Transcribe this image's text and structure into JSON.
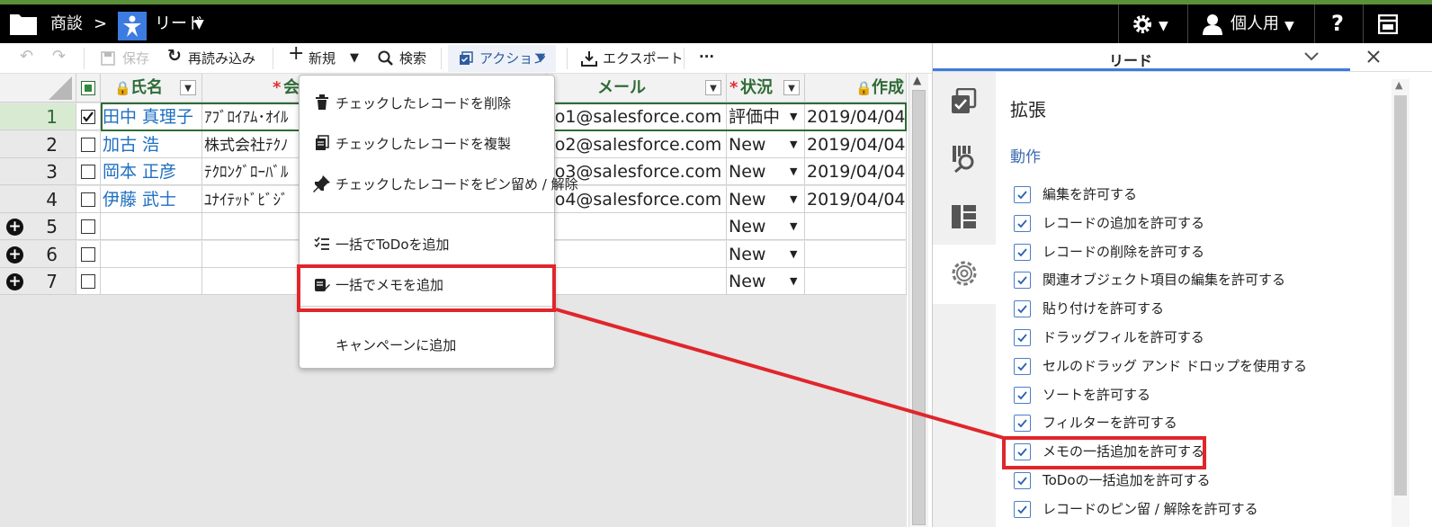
{
  "topbar": {
    "app": "商談",
    "sep": ">",
    "object": "リード",
    "user": "個人用",
    "help": "?"
  },
  "toolbar": {
    "save": "保存",
    "reload": "再読み込み",
    "new": "新規",
    "search": "検索",
    "action": "アクション",
    "export": "エクスポート",
    "more": "···"
  },
  "grid": {
    "headers": [
      "氏名",
      "会",
      "メール",
      "状況",
      "作成"
    ],
    "rows": [
      {
        "num": "1",
        "name": "田中 真理子",
        "company": "ｱﾌﾞﾛｲｱﾑ･ｵｲﾙ",
        "email": "fo1@salesforce.com",
        "status": "評価中",
        "date": "2019/04/04"
      },
      {
        "num": "2",
        "name": "加古 浩",
        "company": "株式会社ﾃｸﾉ",
        "email": "fo2@salesforce.com",
        "status": "New",
        "date": "2019/04/04"
      },
      {
        "num": "3",
        "name": "岡本 正彦",
        "company": "ﾃｸﾛﾝｸﾞﾛｰﾊﾞﾙ",
        "email": "fo3@salesforce.com",
        "status": "New",
        "date": "2019/04/04"
      },
      {
        "num": "4",
        "name": "伊藤 武士",
        "company": "ﾕﾅｲﾃｯﾄﾞﾋﾞｼﾞ",
        "email": "fo4@salesforce.com",
        "status": "New",
        "date": "2019/04/04"
      },
      {
        "num": "5",
        "name": "",
        "company": "",
        "email": "",
        "status": "New",
        "date": ""
      },
      {
        "num": "6",
        "name": "",
        "company": "",
        "email": "",
        "status": "New",
        "date": ""
      },
      {
        "num": "7",
        "name": "",
        "company": "",
        "email": "",
        "status": "New",
        "date": ""
      }
    ]
  },
  "menu": {
    "items": [
      "チェックしたレコードを削除",
      "チェックしたレコードを複製",
      "チェックしたレコードをピン留め / 解除",
      "一括でToDoを追加",
      "一括でメモを追加",
      "キャンペーンに追加"
    ]
  },
  "panel": {
    "tab": "リード",
    "title": "拡張",
    "section": "動作",
    "options": [
      "編集を許可する",
      "レコードの追加を許可する",
      "レコードの削除を許可する",
      "関連オブジェクト項目の編集を許可する",
      "貼り付けを許可する",
      "ドラッグフィルを許可する",
      "セルのドラッグ アンド ドロップを使用する",
      "ソートを許可する",
      "フィルターを許可する",
      "メモの一括追加を許可する",
      "ToDoの一括追加を許可する",
      "レコードのピン留 / 解除を許可する"
    ]
  },
  "colors": {
    "highlight": "#e0262b",
    "header_green": "#2e6b36",
    "link_blue": "#1e6fc1",
    "required_red": "#e03030"
  }
}
